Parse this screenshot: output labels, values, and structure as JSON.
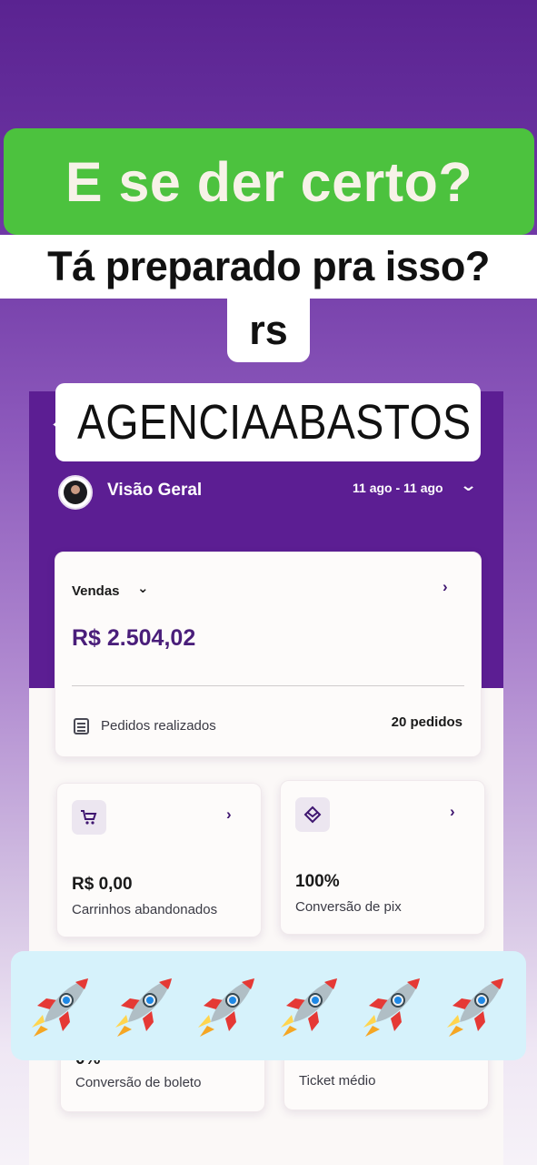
{
  "overlay": {
    "headline": "E se der certo?",
    "subline": "Tá preparado pra isso?",
    "aside": "rs",
    "handle": "AGENCIAABASTOS",
    "rocket_count": 6,
    "colors": {
      "headline_bg": "#4cc23e",
      "rockets_bg": "#d6f2fb"
    }
  },
  "app": {
    "header": {
      "title": "Visão Geral",
      "date_range": "11 ago - 11 ago"
    },
    "sales_card": {
      "label": "Vendas",
      "value": "R$ 2.504,02",
      "orders_label": "Pedidos realizados",
      "orders_value": "20 pedidos"
    },
    "cards": [
      {
        "value": "R$ 0,00",
        "label": "Carrinhos abandonados",
        "icon": "cart-icon"
      },
      {
        "value": "100%",
        "label": "Conversão de pix",
        "icon": "pix-icon"
      },
      {
        "value": "0%",
        "label": "Conversão de boleto"
      },
      {
        "value": "",
        "label": "Ticket médio"
      }
    ],
    "colors": {
      "header_bg": "#5c1e93",
      "accent": "#4a1e7a"
    }
  }
}
